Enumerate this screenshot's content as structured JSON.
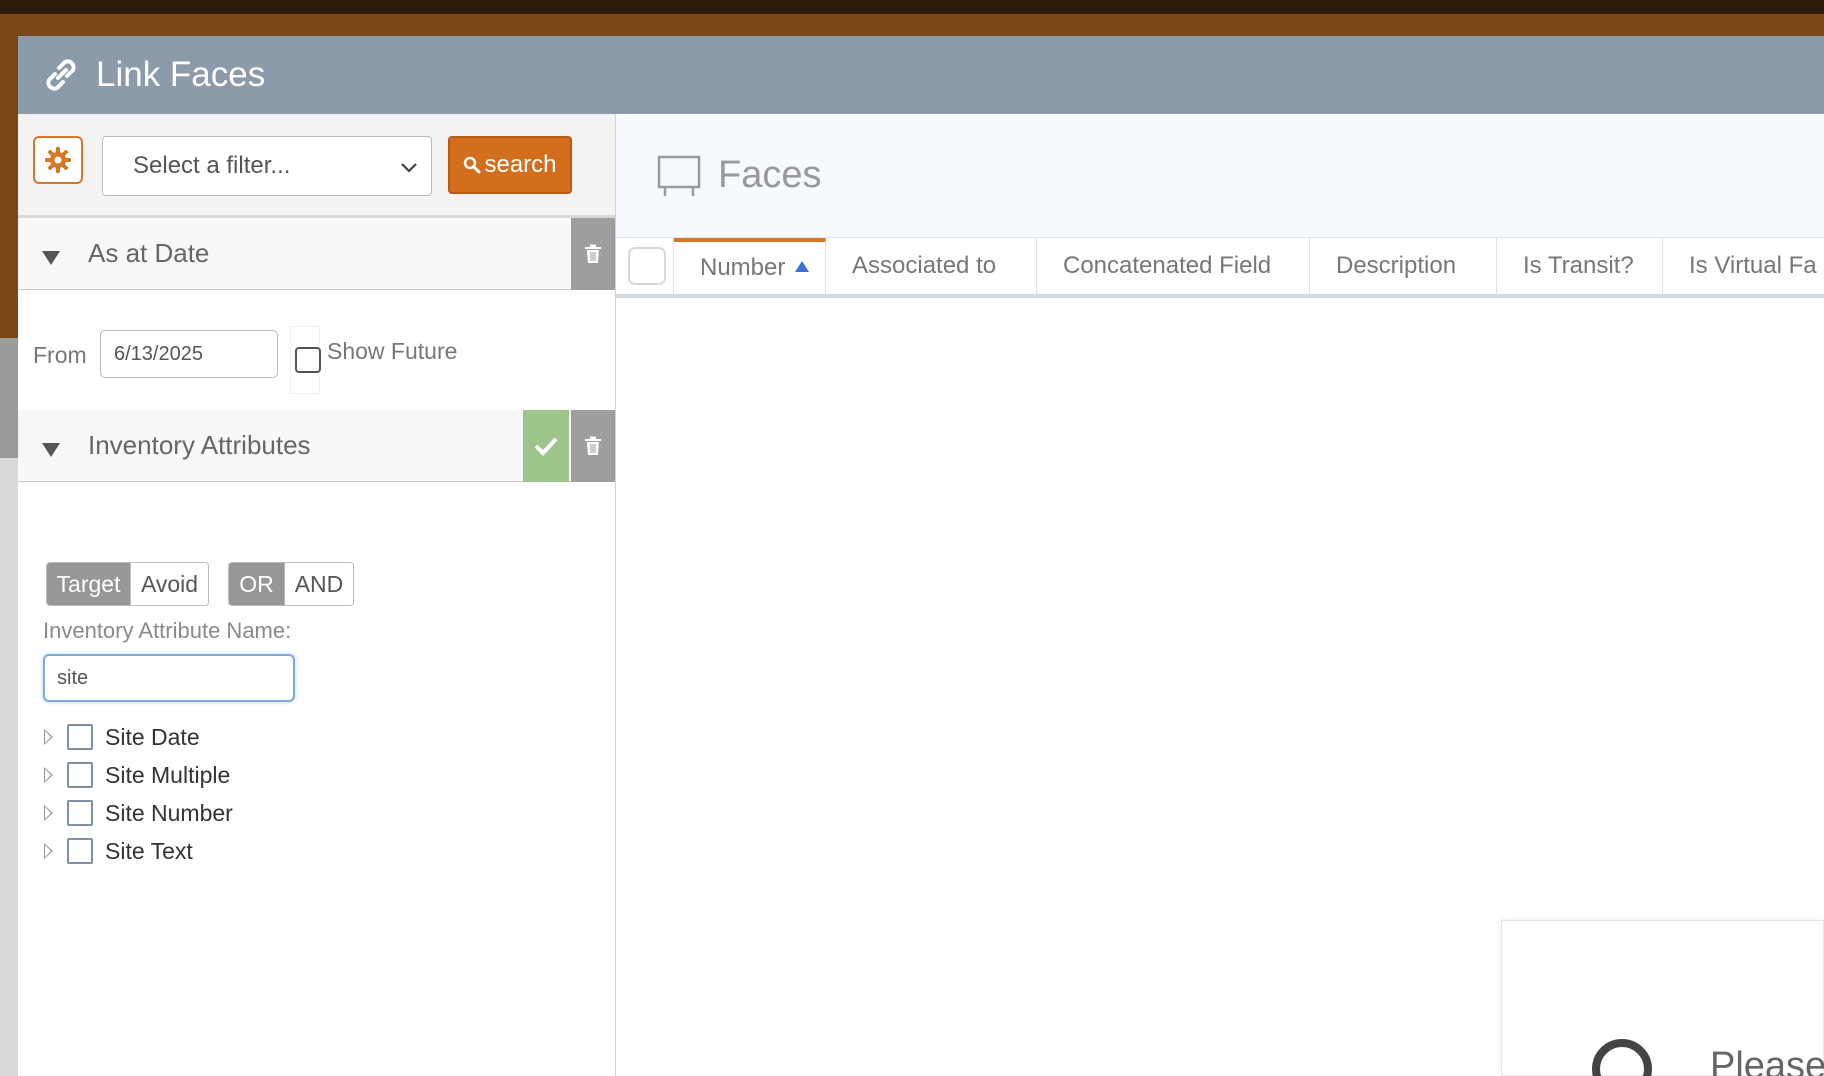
{
  "modal": {
    "title": "Link Faces",
    "icon": "link-icon"
  },
  "filter_bar": {
    "settings_icon": "gear-icon",
    "select_placeholder": "Select a filter...",
    "search_label": "search"
  },
  "as_at_date": {
    "title": "As at Date",
    "from_label": "From",
    "from_value": "6/13/2025",
    "show_future_label": "Show Future",
    "show_future_checked": false
  },
  "inventory_attributes": {
    "title": "Inventory Attributes",
    "mode_toggle": {
      "target": "Target",
      "avoid": "Avoid",
      "selected": "Target"
    },
    "logic_toggle": {
      "or": "OR",
      "and": "AND",
      "selected": "OR"
    },
    "name_label": "Inventory Attribute Name:",
    "name_value": "site",
    "items": [
      {
        "label": "Site Date",
        "checked": false
      },
      {
        "label": "Site Multiple",
        "checked": false
      },
      {
        "label": "Site Number",
        "checked": false
      },
      {
        "label": "Site Text",
        "checked": false
      }
    ]
  },
  "faces": {
    "title": "Faces",
    "icon": "billboard-icon",
    "columns": [
      "Number",
      "Associated to",
      "Concatenated Field",
      "Description",
      "Is Transit?",
      "Is Virtual Fa"
    ],
    "sorted_column": "Number",
    "sort_direction": "ascending"
  },
  "loading": {
    "text": "Please"
  },
  "colors": {
    "accent": "#d36e1c",
    "header": "#8c9aaa",
    "confirm": "#9dc48a",
    "delete": "#9e9e9e",
    "sort_arrow": "#3c6fd9"
  }
}
